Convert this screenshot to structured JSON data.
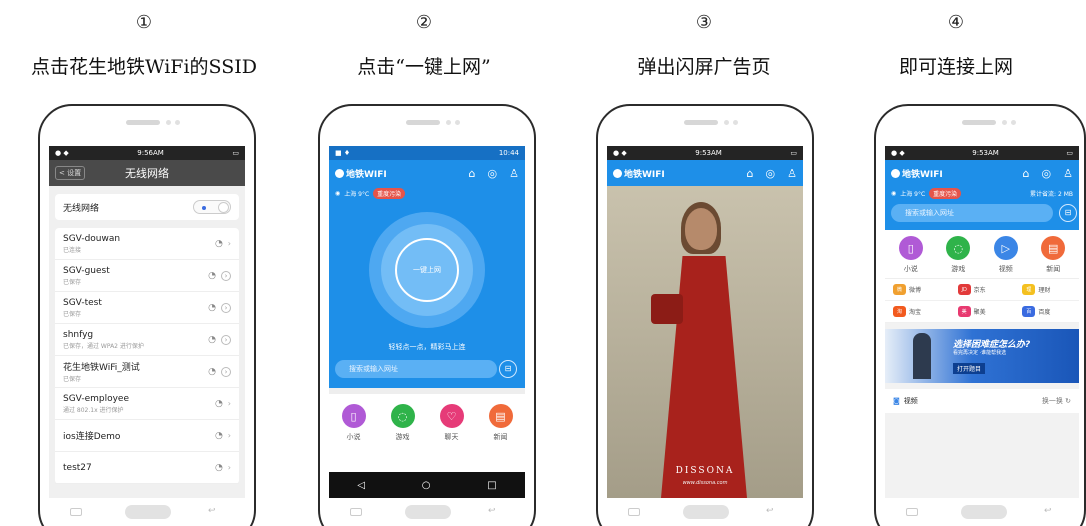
{
  "steps": [
    {
      "num": "①",
      "caption": "点击花生地铁WiFi的SSID"
    },
    {
      "num": "②",
      "caption": "点击“一键上网”"
    },
    {
      "num": "③",
      "caption": "弹出闪屏广告页"
    },
    {
      "num": "④",
      "caption": "即可连接上网"
    }
  ],
  "screen1": {
    "status_time": "9:56AM",
    "back_label": "< 设置",
    "title": "无线网络",
    "wifi_toggle_label": "无线网络",
    "networks": [
      {
        "ssid": "SGV-douwan",
        "status": "已连接"
      },
      {
        "ssid": "SGV-guest",
        "status": "已保存"
      },
      {
        "ssid": "SGV-test",
        "status": "已保存"
      },
      {
        "ssid": "shnfyg",
        "status": "已保存，通过 WPA2 进行保护"
      },
      {
        "ssid": "花生地铁WiFi_测试",
        "status": "已保存"
      },
      {
        "ssid": "SGV-employee",
        "status": "通过 802.1x 进行保护"
      },
      {
        "ssid": "ios连接Demo",
        "status": ""
      },
      {
        "ssid": "test27",
        "status": ""
      }
    ]
  },
  "app": {
    "logo": "地铁WIFI",
    "weather": "上海 9°C",
    "pollution": "重度污染",
    "traffic": "累计省流: 2 MB",
    "search_placeholder": "搜索或输入网址"
  },
  "screen2": {
    "status_time": "10:44",
    "connect_label": "一键上网",
    "tagline": "轻轻点一点，精彩马上连",
    "categories": [
      {
        "label": "小说",
        "icon": "book-icon",
        "color": "#b05ad6"
      },
      {
        "label": "游戏",
        "icon": "gamepad-icon",
        "color": "#2fb34a"
      },
      {
        "label": "聊天",
        "icon": "chat-icon",
        "color": "#e63b78"
      },
      {
        "label": "新闻",
        "icon": "news-icon",
        "color": "#f06a3a"
      }
    ]
  },
  "screen3": {
    "status_time": "9:53AM",
    "ad_brand": "DISSONA",
    "ad_url": "www.dissona.com"
  },
  "screen4": {
    "status_time": "9:53AM",
    "categories": [
      {
        "label": "小说",
        "color": "#b05ad6"
      },
      {
        "label": "游戏",
        "color": "#2fb34a"
      },
      {
        "label": "视频",
        "color": "#3b86e6"
      },
      {
        "label": "新闻",
        "color": "#f06a3a"
      }
    ],
    "shops": [
      {
        "label": "微博",
        "badge": "微",
        "color": "#f0a030"
      },
      {
        "label": "京东",
        "badge": "JD",
        "color": "#e23a3a"
      },
      {
        "label": "理财",
        "badge": "理",
        "color": "#f4c020"
      },
      {
        "label": "淘宝",
        "badge": "淘",
        "color": "#f25a1e"
      },
      {
        "label": "聚美",
        "badge": "美",
        "color": "#e83a70"
      },
      {
        "label": "百度",
        "badge": "百",
        "color": "#3a6be0"
      }
    ],
    "banner_title": "选择困难症怎么办?",
    "banner_sub": "看完再决定 ·谁能帮我选",
    "banner_btn": "打开题目",
    "video_label": "视频",
    "refresh_label": "换一换"
  }
}
